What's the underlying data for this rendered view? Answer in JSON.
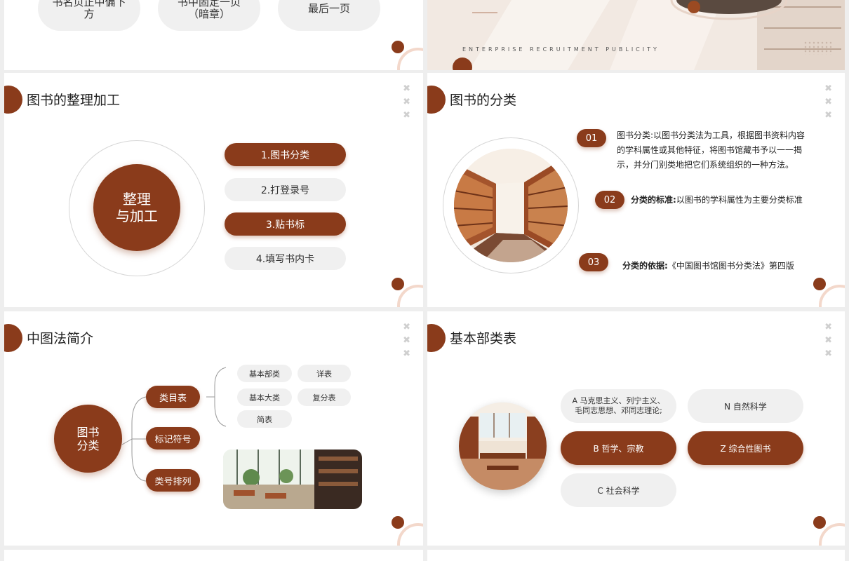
{
  "slide_top_left": {
    "pills": [
      "书名页正中偏下\n方",
      "书中固定一页\n（暗章）",
      "最后一页"
    ]
  },
  "slide_top_right": {
    "caption": "ENTERPRISE RECRUITMENT PUBLICITY"
  },
  "slide_processing": {
    "title": "图书的整理加工",
    "center_label": "整理\n与加工",
    "steps": [
      "1.图书分类",
      "2.打登录号",
      "3.贴书标",
      "4.填写书内卡"
    ]
  },
  "slide_classification": {
    "title": "图书的分类",
    "items": [
      {
        "num": "01",
        "bold": "",
        "text": "图书分类:以图书分类法为工具，根据图书资料内容的学科属性或其他特征，将图书馆藏书予以一一揭示，并分门别类地把它们系统组织的一种方法。"
      },
      {
        "num": "02",
        "bold": "分类的标准:",
        "text": "以图书的学科属性为主要分类标准"
      },
      {
        "num": "03",
        "bold": "分类的依据:",
        "text": "《中国图书馆图书分类法》第四版"
      }
    ]
  },
  "slide_clc": {
    "title": "中图法简介",
    "center_label": "图书\n分类",
    "branches": [
      "类目表",
      "标记符号",
      "类号排列"
    ],
    "sub_items": [
      "基本部类",
      "详表",
      "基本大类",
      "复分表",
      "简表"
    ]
  },
  "slide_basic": {
    "title": "基本部类表",
    "cells": [
      "A 马克思主义、列宁主义、\n毛同志思想、邓同志理论;",
      "N 自然科学",
      "B 哲学、宗教",
      "Z 综合性图书",
      "C 社会科学"
    ]
  },
  "colors": {
    "accent": "#8a3b1b",
    "light_grey": "#f0f0f0",
    "arc": "#f3d8cb"
  }
}
